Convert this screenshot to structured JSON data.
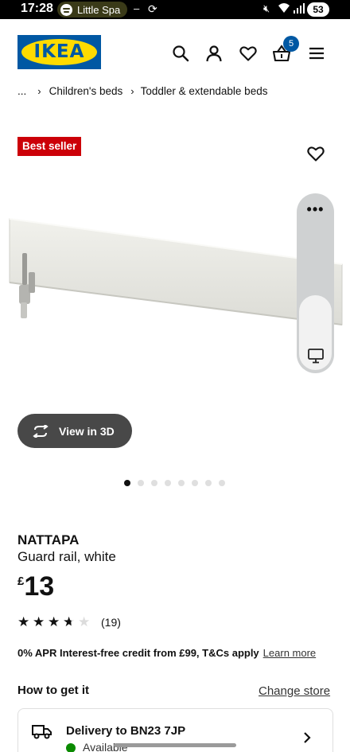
{
  "status_bar": {
    "time": "17:28",
    "media_pill": "Little Spa",
    "dash": "–",
    "battery": "53"
  },
  "header": {
    "logo_text": "IKEA",
    "cart_count": "5",
    "icons": [
      "search-icon",
      "account-icon",
      "heart-icon",
      "basket-icon",
      "menu-icon"
    ]
  },
  "breadcrumb": {
    "ellipsis": "...",
    "items": [
      "Children's beds",
      "Toddler & extendable beds"
    ]
  },
  "badge": "Best seller",
  "media": {
    "panel_menu": "•••",
    "view3d_label": "View in 3D",
    "image_count": 8,
    "active_image": 1
  },
  "product": {
    "name": "NATTAPA",
    "description": "Guard rail, white",
    "currency": "£",
    "price": "13",
    "rating": 3.5,
    "rating_count": "(19)"
  },
  "finance": {
    "text": "0% APR Interest-free credit from £99, T&Cs apply",
    "link": "Learn more"
  },
  "get_it": {
    "heading": "How to get it",
    "change_store": "Change store",
    "delivery_title": "Delivery to BN23 7JP",
    "delivery_status": "Available"
  },
  "colors": {
    "ikea_blue": "#0058a3",
    "ikea_yellow": "#ffdb00",
    "best_seller_red": "#cc0008",
    "available_green": "#0a8a00"
  }
}
